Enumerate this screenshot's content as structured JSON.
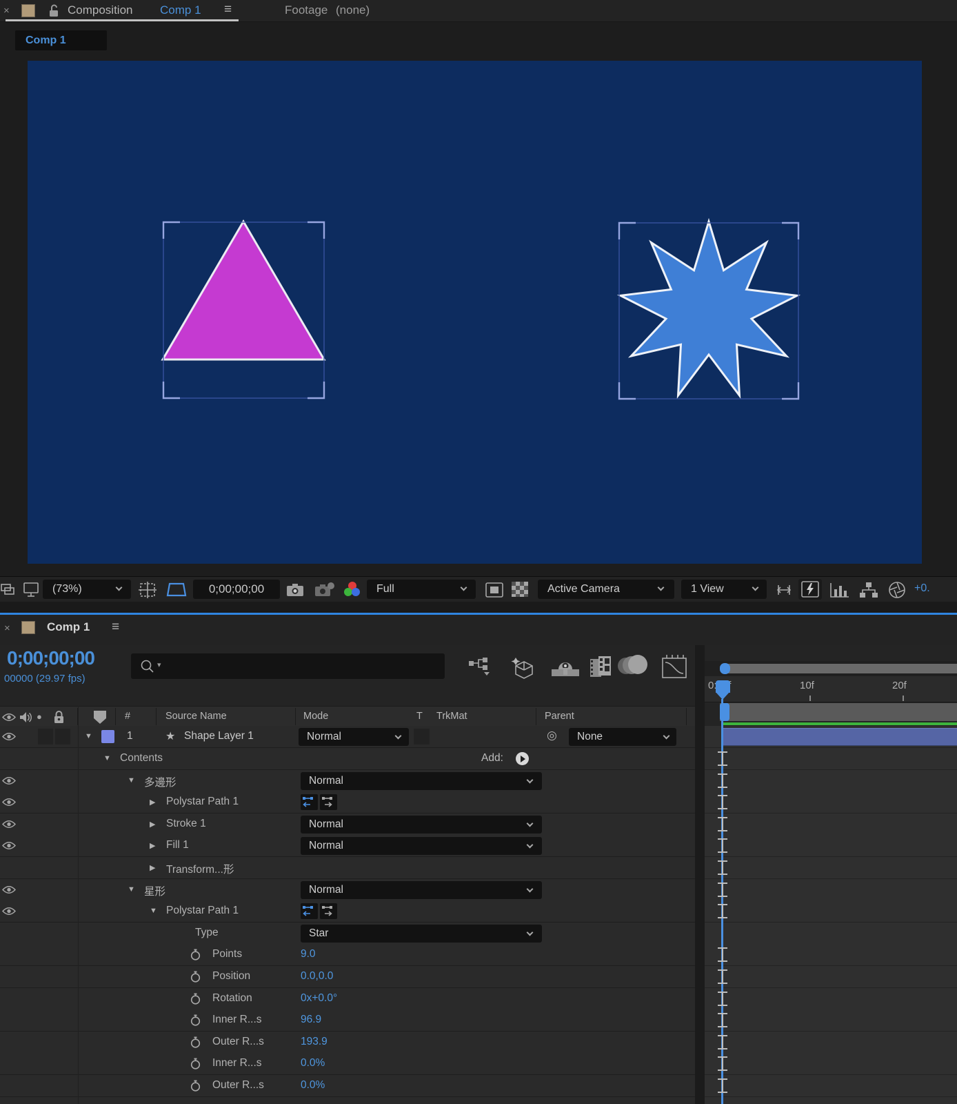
{
  "icons": {
    "close": "×",
    "menu": "≡",
    "star": "★",
    "pickwhip": "◎",
    "tri_down": "▼",
    "tri_right": "▶",
    "solo": "●",
    "search_caret": "▾"
  },
  "composition_tab": {
    "title": "Composition",
    "comp_name": "Comp 1"
  },
  "footage_tab": {
    "title": "Footage",
    "detail": "(none)"
  },
  "viewer_tab": {
    "label": "Comp 1"
  },
  "viewport": {
    "star_points": 9
  },
  "viewport_toolbar": {
    "zoom": "(73%)",
    "timecode": "0;00;00;00",
    "resolution": "Full",
    "camera": "Active Camera",
    "view": "1 View",
    "exposure": "+0."
  },
  "timeline": {
    "tab": "Comp 1",
    "timecode": "0;00;00;00",
    "frame_info": "00000 (29.97 fps)",
    "columns": {
      "number": "#",
      "source": "Source Name",
      "mode": "Mode",
      "t": "T",
      "trkmat": "TrkMat",
      "parent": "Parent"
    },
    "layer": {
      "index": "1",
      "name": "Shape Layer 1",
      "mode": "Normal",
      "parent": "None"
    },
    "add_label": "Add:",
    "ruler": {
      "t0": "0:00f",
      "t10": "10f",
      "t20": "20f"
    },
    "rows": [
      {
        "label": "Contents",
        "expander": "open",
        "indent": 1,
        "control": "add",
        "ibeam": true
      },
      {
        "label": "多邊形",
        "expander": "open",
        "indent": 2,
        "eye": true,
        "control": "dd",
        "value": "Normal",
        "ibeam": true
      },
      {
        "label": "Polystar Path 1",
        "expander": "closed",
        "indent": 3,
        "eye": true,
        "control": "path",
        "ibeam": true
      },
      {
        "label": "Stroke 1",
        "expander": "closed",
        "indent": 3,
        "eye": true,
        "control": "dd",
        "value": "Normal",
        "ibeam": true
      },
      {
        "label": "Fill 1",
        "expander": "closed",
        "indent": 3,
        "eye": true,
        "control": "dd",
        "value": "Normal",
        "ibeam": true
      },
      {
        "label": "Transform...形",
        "expander": "closed",
        "indent": 3,
        "control": "none",
        "ibeam": true
      },
      {
        "label": "星形",
        "expander": "open",
        "indent": 2,
        "eye": true,
        "control": "dd",
        "value": "Normal",
        "ibeam": true
      },
      {
        "label": "Polystar Path 1",
        "expander": "open",
        "indent": 3,
        "eye": true,
        "control": "path",
        "ibeam": true
      },
      {
        "label": "Type",
        "indent": 4,
        "control": "dd",
        "value": "Star",
        "ibeam": false
      },
      {
        "label": "Points",
        "indent": 4,
        "stopwatch": true,
        "control": "value",
        "value": "9.0",
        "ibeam": true
      },
      {
        "label": "Position",
        "indent": 4,
        "stopwatch": true,
        "control": "value",
        "value": "0.0,0.0",
        "ibeam": true
      },
      {
        "label": "Rotation",
        "indent": 4,
        "stopwatch": true,
        "control": "value",
        "value": "0x+0.0°",
        "ibeam": true
      },
      {
        "label": "Inner R...s",
        "indent": 4,
        "stopwatch": true,
        "control": "value",
        "value": "96.9",
        "ibeam": true
      },
      {
        "label": "Outer R...s",
        "indent": 4,
        "stopwatch": true,
        "control": "value",
        "value": "193.9",
        "ibeam": true
      },
      {
        "label": "Inner R...s",
        "indent": 4,
        "stopwatch": true,
        "control": "value",
        "value": "0.0%",
        "ibeam": true
      },
      {
        "label": "Outer R...s",
        "indent": 4,
        "stopwatch": true,
        "control": "value",
        "value": "0.0%",
        "ibeam": true
      }
    ]
  },
  "colors": {
    "accent_blue": "#4a90d9",
    "value_blue": "#4f97e0",
    "comp_bg": "#0d2c5f",
    "triangle_fill": "#c53ad1",
    "triangle_stroke": "#eceaf2",
    "star_fill": "#3f7fd6",
    "star_stroke": "#eef2f8",
    "layer_bar": "#5565a5",
    "render_green": "#3db33d",
    "playhead": "#4a90e2",
    "label_swatch": "#7a87e6",
    "tab_swatch": "#b19b79",
    "selection_box": "#3a55a5",
    "selection_corner": "#96a5e0"
  }
}
